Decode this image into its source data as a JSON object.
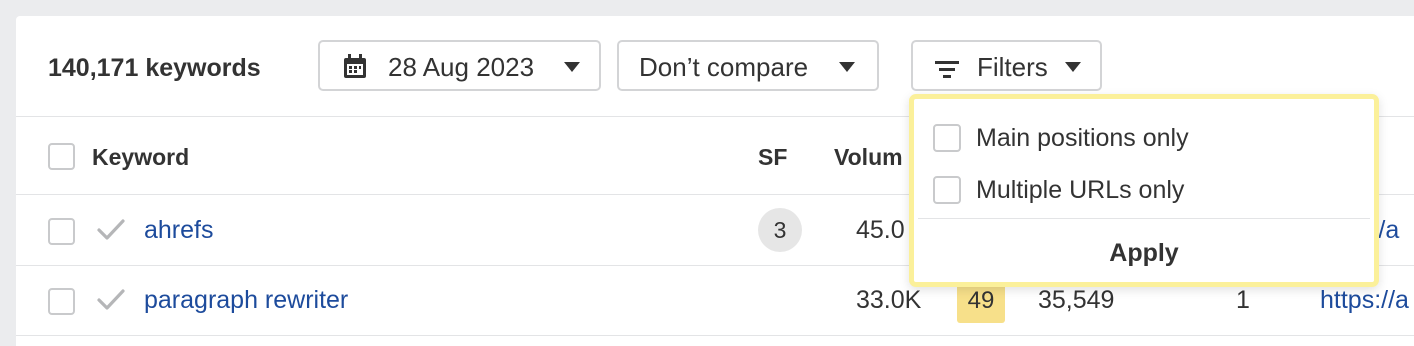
{
  "toolbar": {
    "keyword_count": "140,171 keywords",
    "date_label": "28 Aug 2023",
    "compare_label": "Don’t compare",
    "filters_label": "Filters"
  },
  "table": {
    "headers": {
      "keyword": "Keyword",
      "sf": "SF",
      "volume": "Volum"
    },
    "rows": [
      {
        "keyword": "ahrefs",
        "sf": "3",
        "volume": "45.0",
        "kd": "",
        "traffic": "",
        "position": "",
        "url": "s://a"
      },
      {
        "keyword": "paragraph rewriter",
        "sf": "",
        "volume": "33.0K",
        "kd": "49",
        "traffic": "35,549",
        "position": "1",
        "url": "https://a"
      }
    ]
  },
  "filters_dropdown": {
    "options": [
      {
        "label": "Main positions only",
        "checked": false
      },
      {
        "label": "Multiple URLs only",
        "checked": false
      }
    ],
    "apply_label": "Apply"
  },
  "colors": {
    "link": "#1d4b9c",
    "kd_badge": "#f7e08a",
    "dropdown_highlight": "#fbf09a",
    "page_bg": "#ebecee"
  }
}
